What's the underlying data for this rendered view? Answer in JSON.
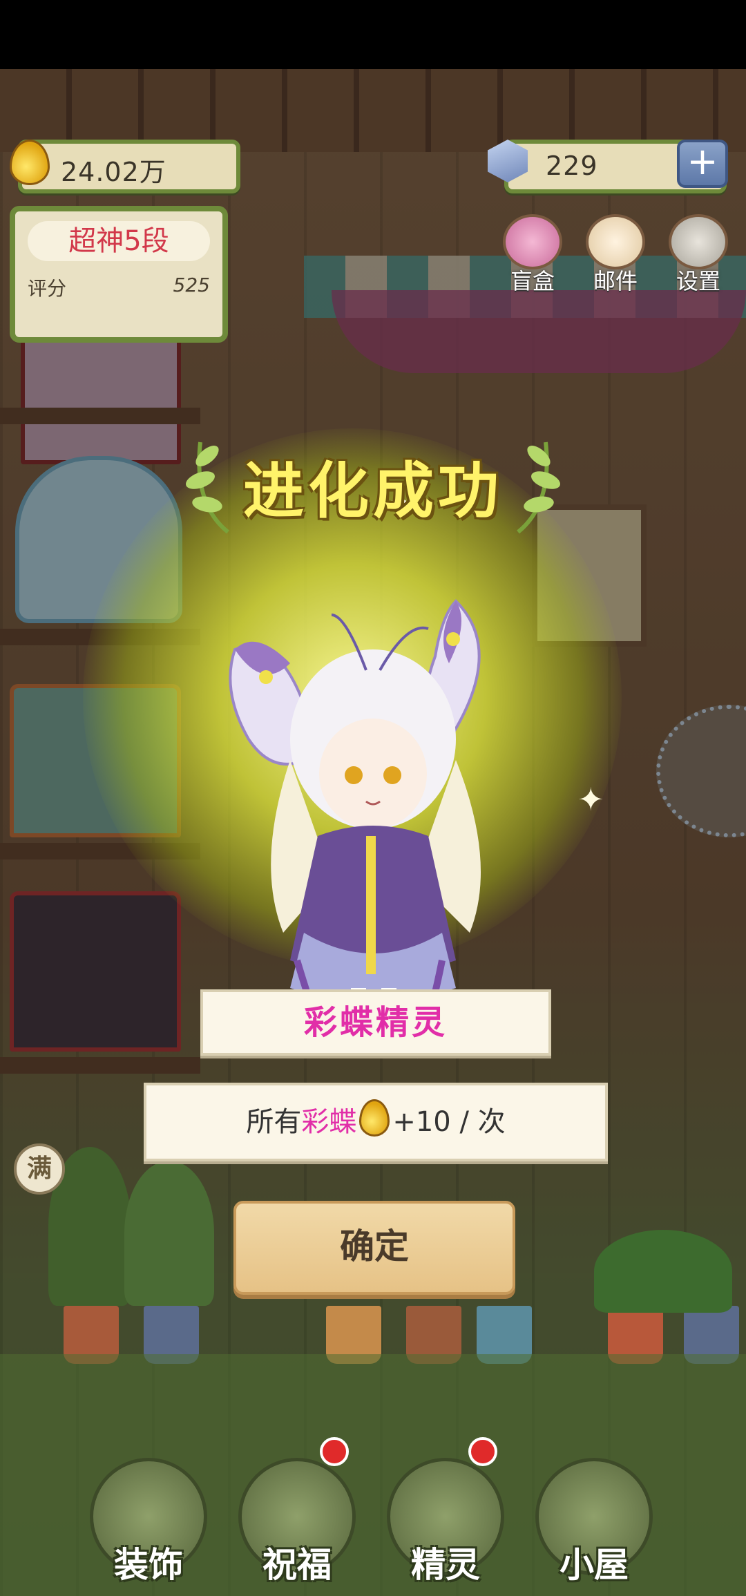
{
  "resources": {
    "honey": "24.02万",
    "gems": "229"
  },
  "rank": {
    "title": "超神5段",
    "score_label": "评分",
    "score_value": "525"
  },
  "top_buttons": [
    {
      "label": "盲盒",
      "icon": "gift-box-icon"
    },
    {
      "label": "邮件",
      "icon": "envelope-icon"
    },
    {
      "label": "设置",
      "icon": "gear-icon"
    }
  ],
  "side_badge": "满",
  "popup": {
    "title": "进化成功",
    "fairy_name": "彩蝶精灵",
    "effect_prefix": "所有",
    "effect_highlight": "彩蝶",
    "effect_suffix": "+10 / 次",
    "confirm_label": "确定"
  },
  "bottom_nav": [
    {
      "label": "装饰",
      "icon": "plant-pot-icon",
      "badge": false
    },
    {
      "label": "祝福",
      "icon": "flower-bouquet-icon",
      "badge": true
    },
    {
      "label": "精灵",
      "icon": "fairy-avatar-icon",
      "badge": true
    },
    {
      "label": "小屋",
      "icon": "house-icon",
      "badge": false
    }
  ],
  "colors": {
    "accent_pink": "#e12ea8",
    "rank_red": "#d2384a",
    "title_yellow": "#fff36a",
    "frame_green": "#6e8a3a"
  }
}
